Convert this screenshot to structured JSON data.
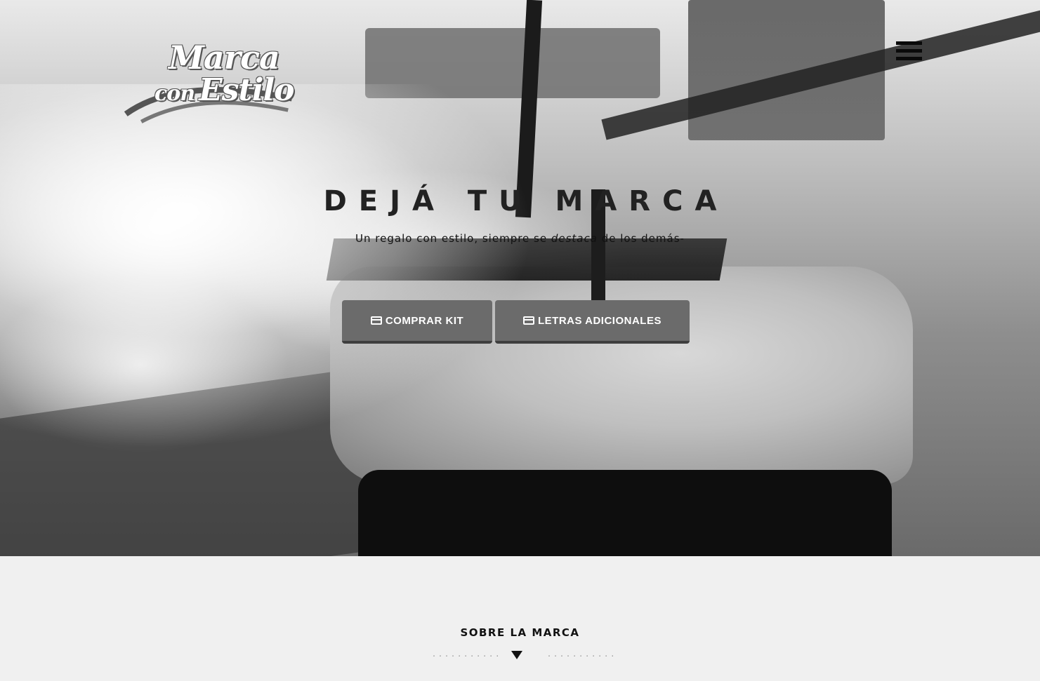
{
  "header": {
    "logo": {
      "line1": "Marca",
      "line2_small": "con",
      "line2": "Estilo"
    },
    "menu_icon": "hamburger-menu-icon"
  },
  "hero": {
    "title": "DEJÁ TU MARCA",
    "subtitle_before": "Un regalo con estilo, siempre se ",
    "subtitle_em": "destaca",
    "subtitle_after": " de los demás-",
    "buttons": {
      "comprar_kit": {
        "icon": "credit-card-icon",
        "label": "COMPRAR KIT"
      },
      "letras_adicionales": {
        "icon": "credit-card-icon",
        "label": "LETRAS ADICIONALES"
      }
    }
  },
  "section": {
    "title": "SOBRE LA MARCA",
    "dots_left": "...........",
    "dots_right": "...........",
    "arrow_icon": "triangle-down-icon"
  },
  "colors": {
    "page_bg": "#f0f0f0",
    "button_bg": "#6b6b6b",
    "button_text": "#ffffff",
    "text_dark": "#111111"
  }
}
